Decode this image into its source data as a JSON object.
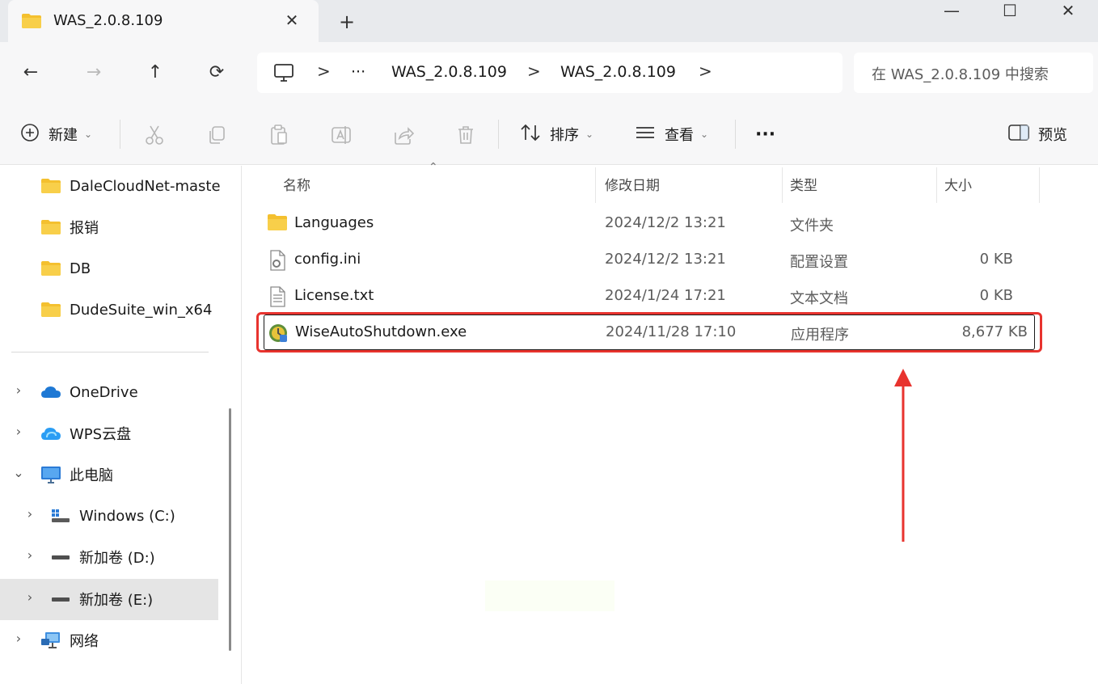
{
  "window": {
    "tab_title": "WAS_2.0.8.109",
    "tab_close": "✕",
    "new_tab": "+",
    "minimize": "—",
    "maximize": "☐",
    "close": "✕"
  },
  "nav": {
    "back": "←",
    "forward": "→",
    "up": "↑",
    "refresh": "⟳"
  },
  "address": {
    "overflow": "···",
    "crumbs": [
      "WAS_2.0.8.109",
      "WAS_2.0.8.109"
    ],
    "separator": ">",
    "search_placeholder": "在 WAS_2.0.8.109 中搜索"
  },
  "toolbar": {
    "new_label": "新建",
    "sort_label": "排序",
    "view_label": "查看",
    "more_label": "···",
    "preview_label": "预览"
  },
  "sidebar": {
    "folders": [
      "DaleCloudNet-maste",
      "报销",
      "DB",
      "DudeSuite_win_x64"
    ],
    "locations": [
      {
        "label": "OneDrive",
        "icon": "cloud-icon",
        "color": "#1e78d4"
      },
      {
        "label": "WPS云盘",
        "icon": "wps-cloud-icon",
        "color": "#2a9df4"
      },
      {
        "label": "此电脑",
        "icon": "computer-icon",
        "color": "#2b7bd6"
      },
      {
        "label": "Windows (C:)",
        "icon": "windows-drive-icon"
      },
      {
        "label": "新加卷 (D:)",
        "icon": "drive-icon"
      },
      {
        "label": "新加卷 (E:)",
        "icon": "drive-icon"
      },
      {
        "label": "网络",
        "icon": "network-icon"
      }
    ]
  },
  "filelist": {
    "columns": [
      "名称",
      "修改日期",
      "类型",
      "大小"
    ],
    "rows": [
      {
        "name": "Languages",
        "date": "2024/12/2 13:21",
        "type": "文件夹",
        "size": "",
        "icon": "folder-icon"
      },
      {
        "name": "config.ini",
        "date": "2024/12/2 13:21",
        "type": "配置设置",
        "size": "0 KB",
        "icon": "settings-file-icon"
      },
      {
        "name": "License.txt",
        "date": "2024/1/24 17:21",
        "type": "文本文档",
        "size": "0 KB",
        "icon": "text-file-icon"
      },
      {
        "name": "WiseAutoShutdown.exe",
        "date": "2024/11/28 17:10",
        "type": "应用程序",
        "size": "8,677 KB",
        "icon": "app-icon"
      }
    ]
  },
  "colors": {
    "folder": "#f4c02f",
    "annotation_red": "#e8332e",
    "selection": "#e5e5e5"
  }
}
